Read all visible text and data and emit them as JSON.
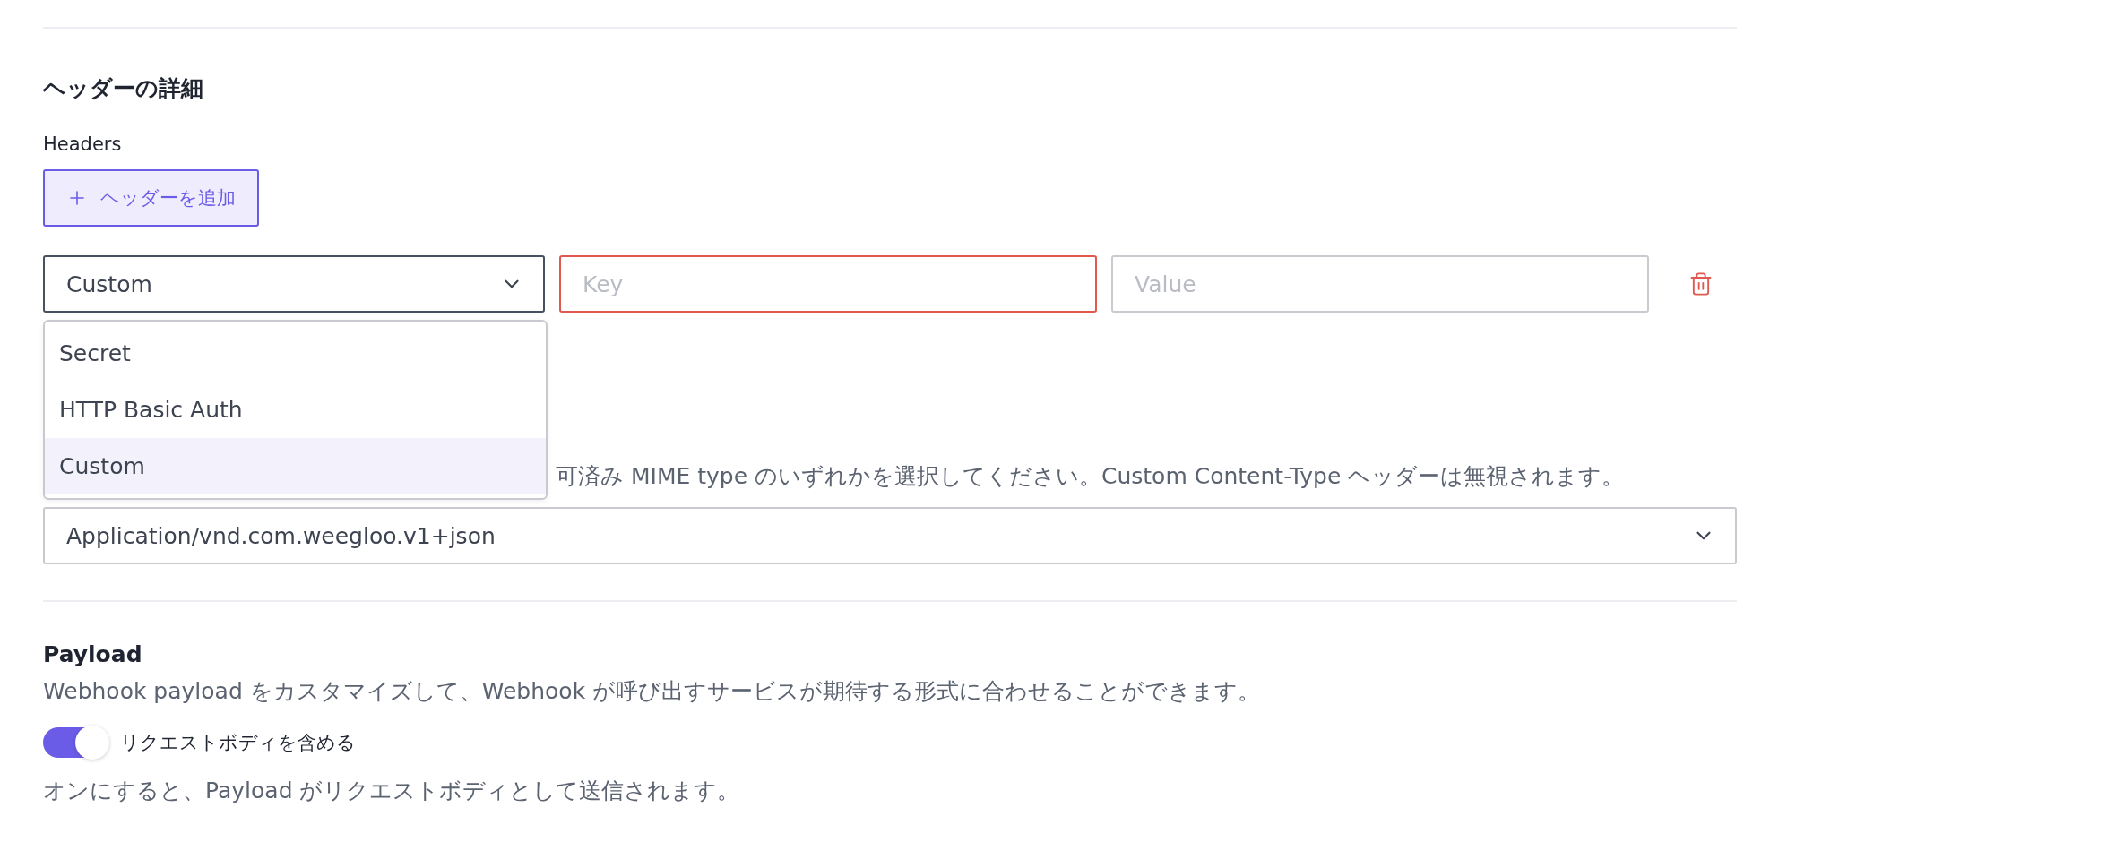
{
  "section_title": "ヘッダーの詳細",
  "headers_label": "Headers",
  "add_button": {
    "label": "ヘッダーを追加"
  },
  "header_row": {
    "type_select": {
      "value": "Custom",
      "expanded": true
    },
    "key": {
      "placeholder": "Key",
      "invalid": true
    },
    "value": {
      "placeholder": "Value"
    }
  },
  "type_menu": [
    {
      "label": "Secret",
      "selected": false
    },
    {
      "label": "HTTP Basic Auth",
      "selected": false
    },
    {
      "label": "Custom",
      "selected": true
    }
  ],
  "content_type": {
    "description": "可済み MIME type のいずれかを選択してください。Custom Content-Type ヘッダーは無視されます。",
    "value": "Application/vnd.com.weegloo.v1+json"
  },
  "payload": {
    "title": "Payload",
    "description": "Webhook payload をカスタマイズして、Webhook が呼び出すサービスが期待する形式に合わせることができます。",
    "toggle": {
      "label": "リクエストボディを含める",
      "on": true
    },
    "note": "オンにすると、Payload がリクエストボディとして送信されます。"
  }
}
